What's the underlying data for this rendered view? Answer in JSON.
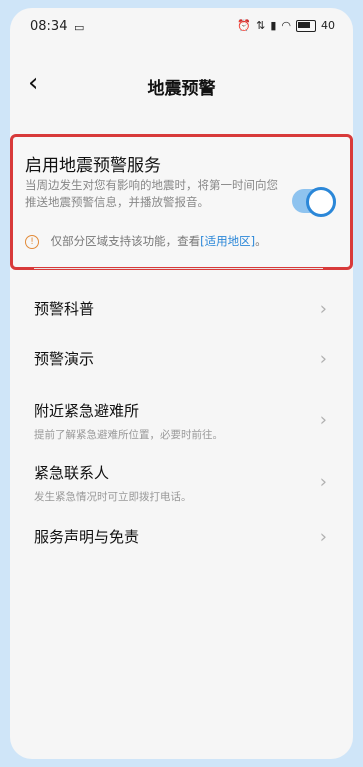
{
  "status": {
    "time": "08:34",
    "battery": "40"
  },
  "header": {
    "title": "地震预警"
  },
  "service": {
    "title": "启用地震预警服务",
    "desc": "当周边发生对您有影响的地震时，将第一时间向您推送地震预警信息，并播放警报音。",
    "enabled": true,
    "note_prefix": "仅部分区域支持该功能，查看",
    "note_link": "[适用地区]",
    "note_suffix": "。"
  },
  "menu": [
    {
      "label": "预警科普",
      "sub": ""
    },
    {
      "label": "预警演示",
      "sub": ""
    },
    {
      "label": "附近紧急避难所",
      "sub": "提前了解紧急避难所位置，必要时前往。"
    },
    {
      "label": "紧急联系人",
      "sub": "发生紧急情况时可立即拨打电话。"
    },
    {
      "label": "服务声明与免责",
      "sub": ""
    }
  ],
  "colors": {
    "accent": "#2b87d8",
    "highlight_border": "#d83a3a",
    "background": "#cfe5f8"
  }
}
